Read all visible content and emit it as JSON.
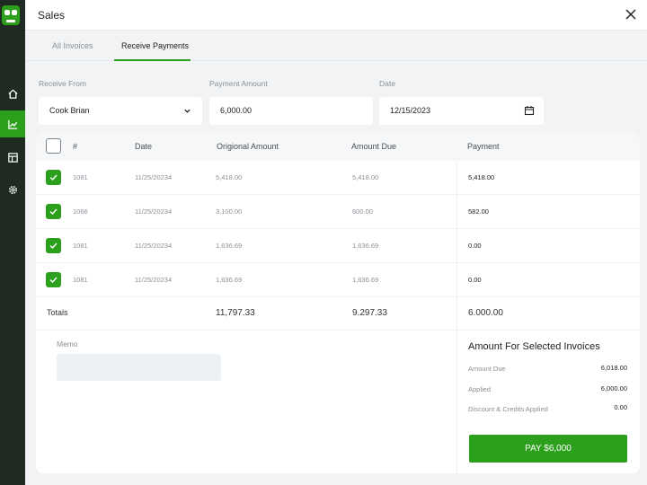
{
  "header": {
    "title": "Sales"
  },
  "tabs": [
    {
      "label": "All Invoices",
      "active": false
    },
    {
      "label": "Receive Payments",
      "active": true
    }
  ],
  "form": {
    "receive_from": {
      "label": "Receive From",
      "value": "Cook Brian"
    },
    "payment_amount": {
      "label": "Payment Amount",
      "value": "6,000.00"
    },
    "date": {
      "label": "Date",
      "value": "12/15/2023"
    }
  },
  "table": {
    "columns": [
      "#",
      "Date",
      "Origional Amount",
      "Amount Due",
      "Payment"
    ],
    "rows": [
      {
        "checked": true,
        "num": "1081",
        "date": "11/25/20234",
        "original": "5,418.00",
        "due": "5,418.00",
        "payment": "5,418.00"
      },
      {
        "checked": true,
        "num": "1066",
        "date": "11/25/20234",
        "original": "3,100.00",
        "due": "600.00",
        "payment": "582.00"
      },
      {
        "checked": true,
        "num": "1081",
        "date": "11/25/20234",
        "original": "1,636.69",
        "due": "1,636.69",
        "payment": "0.00"
      },
      {
        "checked": true,
        "num": "1081",
        "date": "11/25/20234",
        "original": "1,636.69",
        "due": "1,636.69",
        "payment": "0.00"
      }
    ],
    "totals": {
      "label": "Totals",
      "original": "11,797.33",
      "due": "9.297.33",
      "payment": "6.000.00"
    }
  },
  "memo": {
    "label": "Memo",
    "value": ""
  },
  "summary": {
    "title": "Amount For Selected Invoices",
    "lines": [
      {
        "label": "Amount Due",
        "value": "6,018.00"
      },
      {
        "label": "Applied",
        "value": "6,000.00"
      },
      {
        "label": "Discount & Credits Applied",
        "value": "0.00"
      }
    ],
    "pay_label": "PAY $6,000"
  },
  "sidebar": {
    "items": [
      {
        "icon": "home-icon",
        "active": false
      },
      {
        "icon": "chart-icon",
        "active": true
      },
      {
        "icon": "table-icon",
        "active": false
      },
      {
        "icon": "gear-icon",
        "active": false
      }
    ]
  },
  "colors": {
    "accent": "#2ca01c",
    "sidebar": "#1e2a22"
  }
}
